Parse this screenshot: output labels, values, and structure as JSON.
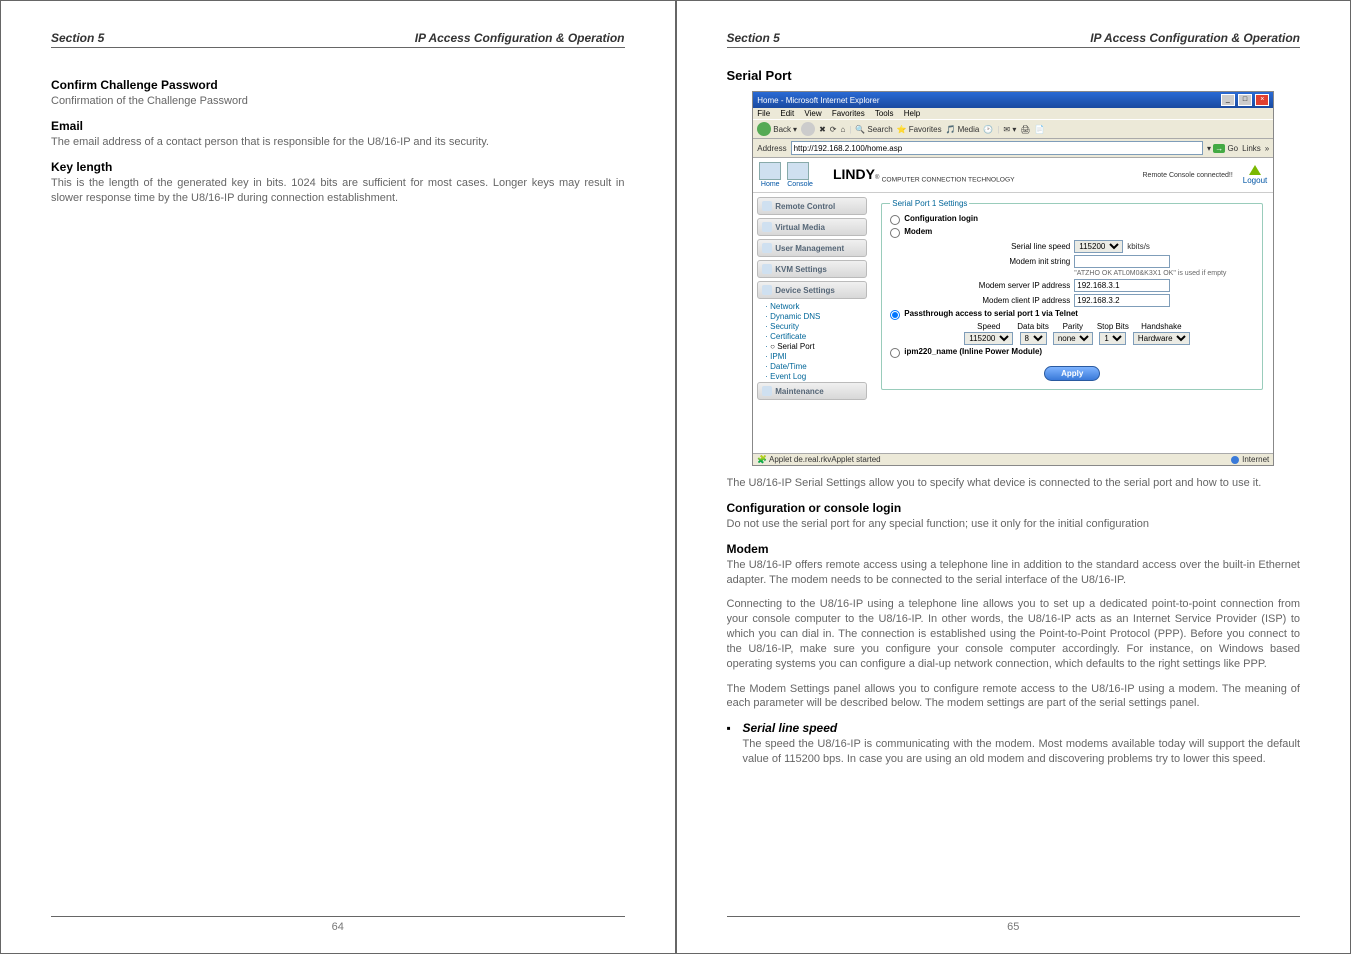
{
  "left": {
    "header_left": "Section 5",
    "header_right": "IP Access Configuration & Operation",
    "h1": "Confirm Challenge Password",
    "p1": "Confirmation of the Challenge Password",
    "h2": "Email",
    "p2": "The email address of a contact person that is responsible for the U8/16-IP and its security.",
    "h3": "Key length",
    "p3": "This is the length of the generated key in bits. 1024 bits are sufficient for most cases. Longer keys may result in slower response time by the U8/16-IP during connection establishment.",
    "page_no": "64"
  },
  "right": {
    "header_left": "Section 5",
    "header_right": "IP Access Configuration & Operation",
    "title": "Serial Port",
    "intro": "The U8/16-IP Serial Settings allow you to specify what device is connected to the serial port and how to use it.",
    "h1": "Configuration or console login",
    "p1": "Do not use the serial port for any special function; use it only for the initial configuration",
    "h2": "Modem",
    "p2a": "The U8/16-IP offers remote access using a telephone line in addition to the standard access over the built-in Ethernet adapter. The modem needs to be connected to the serial interface of the U8/16-IP.",
    "p2b": "Connecting to the U8/16-IP using a telephone line allows you to set up a dedicated point-to-point connection from your console computer to the U8/16-IP. In other words, the U8/16-IP acts as an Internet Service Provider (ISP) to which you can dial in. The connection is established using the Point-to-Point Protocol (PPP). Before you connect to the U8/16-IP, make sure you configure your console computer accordingly. For instance, on Windows based operating systems you can configure a dial-up network connection, which defaults to the right settings like PPP.",
    "p2c": "The Modem Settings panel allows you to configure remote access to the U8/16-IP using a modem. The meaning of each parameter will be described below. The modem settings are part of the serial settings panel.",
    "bullet_title": "Serial line speed",
    "bullet_text": "The speed the U8/16-IP is communicating with the modem. Most modems available today will support the default value of 115200 bps. In case you are using an old modem and discovering problems try to lower this speed.",
    "page_no": "65"
  },
  "ie": {
    "title": "Home - Microsoft Internet Explorer",
    "menu": {
      "file": "File",
      "edit": "Edit",
      "view": "View",
      "favorites": "Favorites",
      "tools": "Tools",
      "help": "Help"
    },
    "toolbar": {
      "back": "Back",
      "search": "Search",
      "favorites": "Favorites",
      "media": "Media"
    },
    "address_label": "Address",
    "address_value": "http://192.168.2.100/home.asp",
    "go": "Go",
    "links": "Links",
    "status_left": "Applet de.real.rkvApplet started",
    "status_right": "Internet"
  },
  "lindy": {
    "home": "Home",
    "console": "Console",
    "logo": "LINDY",
    "logo_sub": "COMPUTER CONNECTION TECHNOLOGY",
    "status": "Remote Console connected!!",
    "logout": "Logout",
    "nav": {
      "remote": "Remote Control",
      "virtual": "Virtual Media",
      "user": "User Management",
      "kvm": "KVM Settings",
      "device": "Device Settings",
      "subs": {
        "network": "Network",
        "dyndns": "Dynamic DNS",
        "security": "Security",
        "cert": "Certificate",
        "serial": "Serial Port",
        "ipmi": "IPMI",
        "datetime": "Date/Time",
        "eventlog": "Event Log"
      },
      "maint": "Maintenance"
    }
  },
  "form": {
    "legend": "Serial Port 1 Settings",
    "opt_config": "Configuration login",
    "opt_modem": "Modem",
    "serial_speed_label": "Serial line speed",
    "serial_speed_value": "115200",
    "serial_speed_unit": "kbits/s",
    "init_label": "Modem init string",
    "init_value": "",
    "init_hint": "\"ATZHO OK ATL0M0&K3X1 OK\" is used if empty",
    "server_ip_label": "Modem server IP address",
    "server_ip_value": "192.168.3.1",
    "client_ip_label": "Modem client IP address",
    "client_ip_value": "192.168.3.2",
    "opt_pass": "Passthrough access to serial port 1 via Telnet",
    "cols": {
      "speed": "Speed",
      "databits": "Data bits",
      "parity": "Parity",
      "stopbits": "Stop Bits",
      "handshake": "Handshake"
    },
    "vals": {
      "speed": "115200",
      "databits": "8",
      "parity": "none",
      "stopbits": "1",
      "handshake": "Hardware"
    },
    "opt_ipm": "ipm220_name (Inline Power Module)",
    "apply": "Apply"
  }
}
